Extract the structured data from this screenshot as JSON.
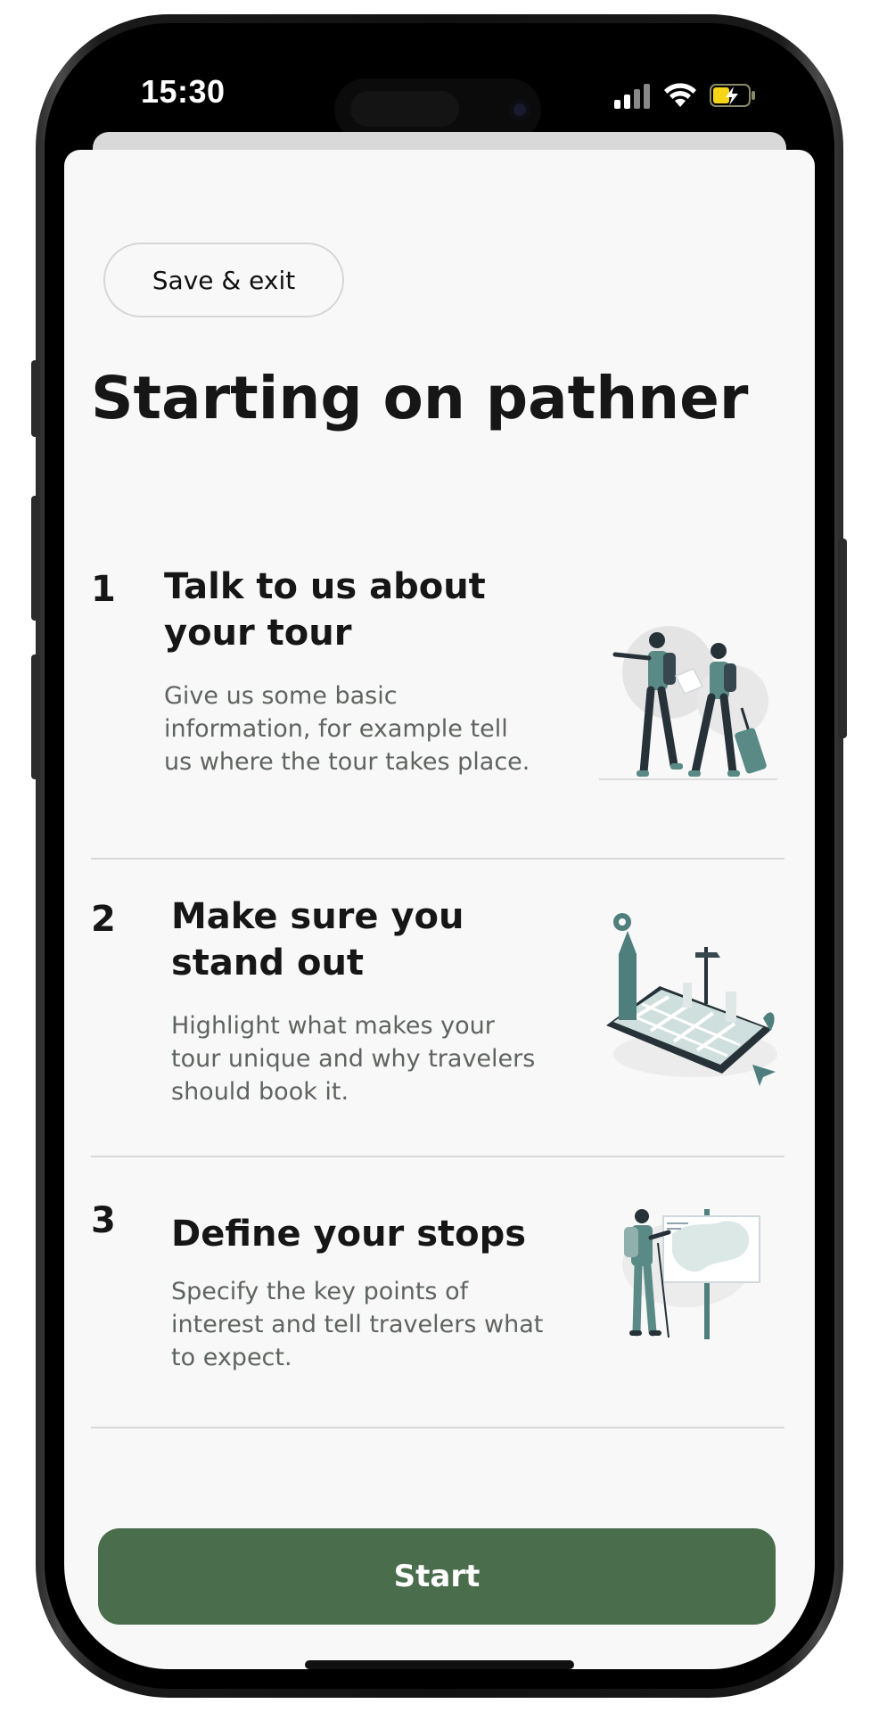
{
  "status_bar": {
    "time": "15:30"
  },
  "header": {
    "save_exit_label": "Save & exit"
  },
  "page": {
    "title": "Starting on pathner"
  },
  "steps": [
    {
      "number": "1",
      "title_line1": "Talk to us about",
      "title_line2": "your tour",
      "description": "Give us some basic information, for example tell us where the tour takes place.",
      "illustration": "travelers-with-map-illustration"
    },
    {
      "number": "2",
      "title_line1": "Make sure you",
      "title_line2": "stand out",
      "description": "Highlight what makes your tour unique and why travelers should book it.",
      "illustration": "city-map-tablet-illustration"
    },
    {
      "number": "3",
      "title_line1": "Define your stops",
      "title_line2": "",
      "description": "Specify the key points of interest and tell travelers what to expect.",
      "illustration": "hiker-at-map-board-illustration"
    }
  ],
  "footer": {
    "start_label": "Start"
  },
  "colors": {
    "accent": "#4a6d4c",
    "illustration_teal": "#4f7f7c",
    "illustration_dark": "#263238",
    "background": "#f8f8f8"
  }
}
